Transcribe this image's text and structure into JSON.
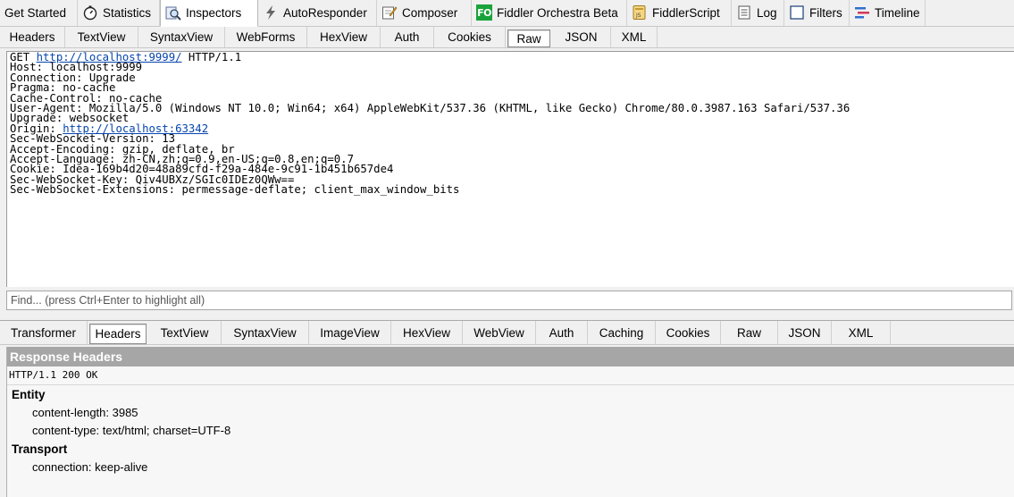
{
  "main_tabs": [
    {
      "label": "Get Started",
      "icon": "none"
    },
    {
      "label": "Statistics",
      "icon": "stopwatch-icon"
    },
    {
      "label": "Inspectors",
      "icon": "inspectors-icon"
    },
    {
      "label": "AutoResponder",
      "icon": "lightning-icon"
    },
    {
      "label": "Composer",
      "icon": "composer-icon"
    },
    {
      "label": "Fiddler Orchestra Beta",
      "icon": "fo-badge-icon",
      "badge": "FO"
    },
    {
      "label": "FiddlerScript",
      "icon": "script-icon"
    },
    {
      "label": "Log",
      "icon": "log-icon"
    },
    {
      "label": "Filters",
      "icon": "checkbox-icon"
    },
    {
      "label": "Timeline",
      "icon": "timeline-icon"
    }
  ],
  "request_tabs": [
    "Headers",
    "TextView",
    "SyntaxView",
    "WebForms",
    "HexView",
    "Auth",
    "Cookies",
    "Raw",
    "JSON",
    "XML"
  ],
  "request_active_tab": "Raw",
  "request_raw": {
    "request_line": {
      "method": "GET",
      "url": "http://localhost:9999/",
      "protocol": "HTTP/1.1"
    },
    "headers": [
      "Host: localhost:9999",
      "Connection: Upgrade",
      "Pragma: no-cache",
      "Cache-Control: no-cache",
      "User-Agent: Mozilla/5.0 (Windows NT 10.0; Win64; x64) AppleWebKit/537.36 (KHTML, like Gecko) Chrome/80.0.3987.163 Safari/537.36",
      "Upgrade: websocket"
    ],
    "origin": {
      "name": "Origin:",
      "url": "http://localhost:63342"
    },
    "headers_after": [
      "Sec-WebSocket-Version: 13",
      "Accept-Encoding: gzip, deflate, br",
      "Accept-Language: zh-CN,zh;q=0.9,en-US;q=0.8,en;q=0.7",
      "Cookie: Idea-169b4d20=48a89cfd-f29a-484e-9c91-1b451b657de4",
      "Sec-WebSocket-Key: Qiv4UBXz/SGIc0IDEz0QWw==",
      "Sec-WebSocket-Extensions: permessage-deflate; client_max_window_bits"
    ]
  },
  "find": {
    "placeholder": "Find... (press Ctrl+Enter to highlight all)",
    "value": ""
  },
  "response_tabs": [
    "Transformer",
    "Headers",
    "TextView",
    "SyntaxView",
    "ImageView",
    "HexView",
    "WebView",
    "Auth",
    "Caching",
    "Cookies",
    "Raw",
    "JSON",
    "XML"
  ],
  "response_active_tab": "Headers",
  "response_headers": {
    "title": "Response Headers",
    "status_line": "HTTP/1.1 200 OK",
    "groups": [
      {
        "name": "Entity",
        "items": [
          "content-length: 3985",
          "content-type: text/html; charset=UTF-8"
        ]
      },
      {
        "name": "Transport",
        "items": [
          "connection: keep-alive"
        ]
      }
    ]
  }
}
